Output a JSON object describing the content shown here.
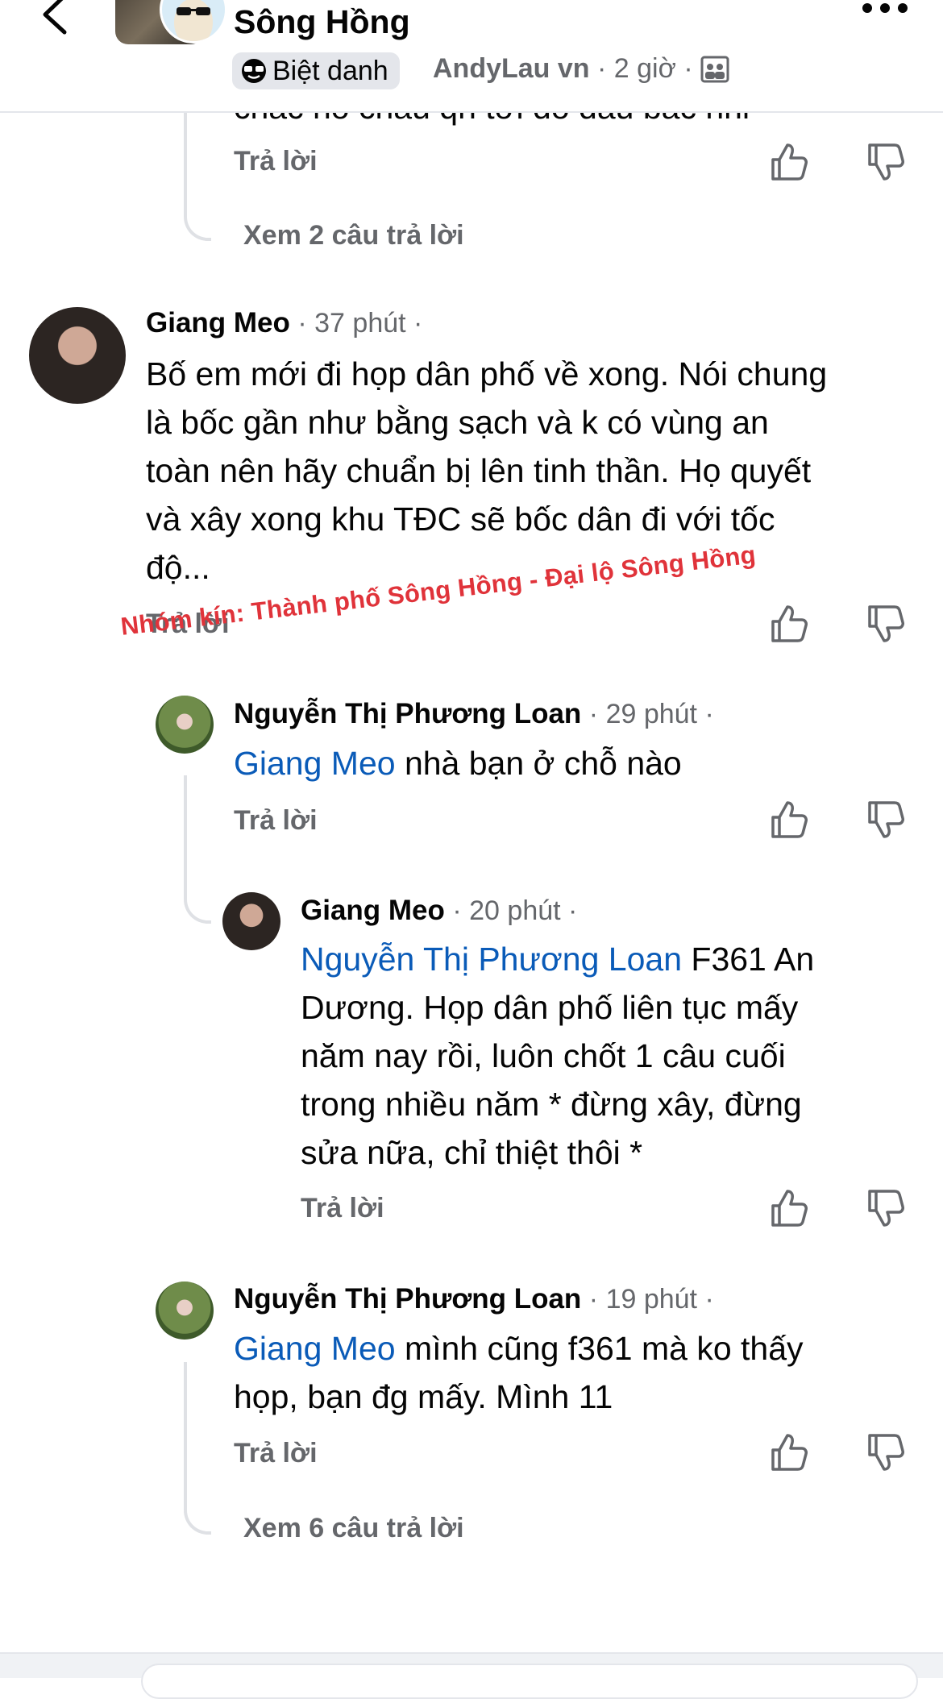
{
  "header": {
    "group_name": "Sông Hồng",
    "nickname_badge": "Biệt danh",
    "author": "AndyLau vn",
    "time": "2 giờ"
  },
  "previous": {
    "partial_text": "chẳc ho chẳu qh tới đó đâu bác nhỉ",
    "reply_label": "Trả lời",
    "see_replies": "Xem 2 câu trả lời"
  },
  "comments": [
    {
      "name": "Giang Meo",
      "time": "37 phút",
      "lines": [
        "Bố em mới đi họp dân phố về xong. Nói chung",
        "là bốc gần như bằng sạch và k có vùng an",
        "toàn nên hãy chuẩn bị lên tinh thần. Họ quyết",
        "và xây xong khu TĐC sẽ bốc dân đi với tốc",
        "độ..."
      ],
      "reply_label": "Trả lời"
    },
    {
      "name": "Nguyễn Thị Phương Loan",
      "time": "29 phút",
      "mention": "Giang Meo",
      "text": " nhà bạn ở chỗ nào",
      "reply_label": "Trả lời"
    },
    {
      "name": "Giang Meo",
      "time": "20 phút",
      "mention": "Nguyễn Thị Phương Loan",
      "first_line_rest": " F361 An",
      "lines": [
        "Dương. Họp dân phố liên tục mấy",
        "năm nay rồi, luôn chốt 1 câu cuối",
        "trong nhiều năm * đừng xây, đừng",
        "sửa nữa, chỉ thiệt thôi *"
      ],
      "reply_label": "Trả lời"
    },
    {
      "name": "Nguyễn Thị Phương Loan",
      "time": "19 phút",
      "mention": "Giang Meo",
      "first_line_rest": " mình cũng f361 mà ko thấy",
      "lines": [
        "họp, bạn đg mấy. Mình 11"
      ],
      "reply_label": "Trả lời",
      "see_replies": "Xem 6 câu trả lời"
    }
  ],
  "watermark": "Nhóm kín: Thành phố Sông Hồng - Đại lộ Sông Hồng",
  "colors": {
    "mention": "#0a5bb8",
    "watermark": "#e0333a",
    "secondary": "#65676b"
  }
}
